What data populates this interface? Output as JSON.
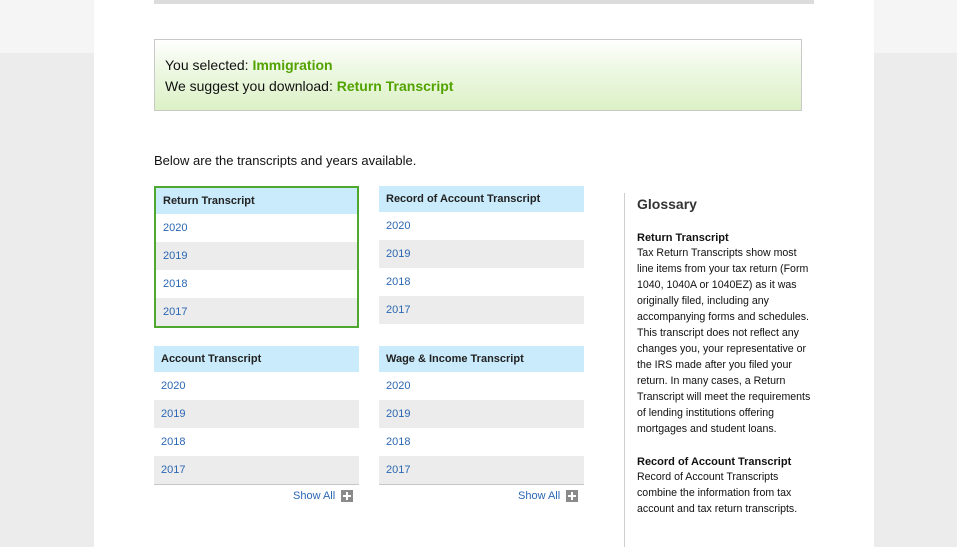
{
  "selection": {
    "selected_prefix": "You selected:",
    "selected_value": "Immigration",
    "suggest_prefix": "We suggest you download:",
    "suggest_value": "Return Transcript"
  },
  "intro_text": "Below are the transcripts and years available.",
  "transcripts": {
    "return": {
      "title": "Return Transcript",
      "years": [
        "2020",
        "2019",
        "2018",
        "2017"
      ]
    },
    "record": {
      "title": "Record of Account Transcript",
      "years": [
        "2020",
        "2019",
        "2018",
        "2017"
      ]
    },
    "account": {
      "title": "Account Transcript",
      "years": [
        "2020",
        "2019",
        "2018",
        "2017"
      ]
    },
    "wage": {
      "title": "Wage & Income Transcript",
      "years": [
        "2020",
        "2019",
        "2018",
        "2017"
      ]
    }
  },
  "show_all_label": "Show All",
  "glossary": {
    "title": "Glossary",
    "entries": [
      {
        "term": "Return Transcript",
        "definition": "Tax Return Transcripts show most line items from your tax return (Form 1040, 1040A or 1040EZ) as it was originally filed, including any accompanying forms and schedules. This transcript does not reflect any changes you, your representative or the IRS made after you filed your return. In many cases, a Return Transcript will meet the requirements of lending institutions offering mortgages and student loans."
      },
      {
        "term": "Record of Account Transcript",
        "definition": "Record of Account Transcripts combine the information from tax account and tax return transcripts."
      }
    ]
  },
  "colors": {
    "highlight_green": "#52a300",
    "selected_border": "#4ea72e",
    "header_blue": "#c9ebfb",
    "link_blue": "#2b67b3"
  }
}
